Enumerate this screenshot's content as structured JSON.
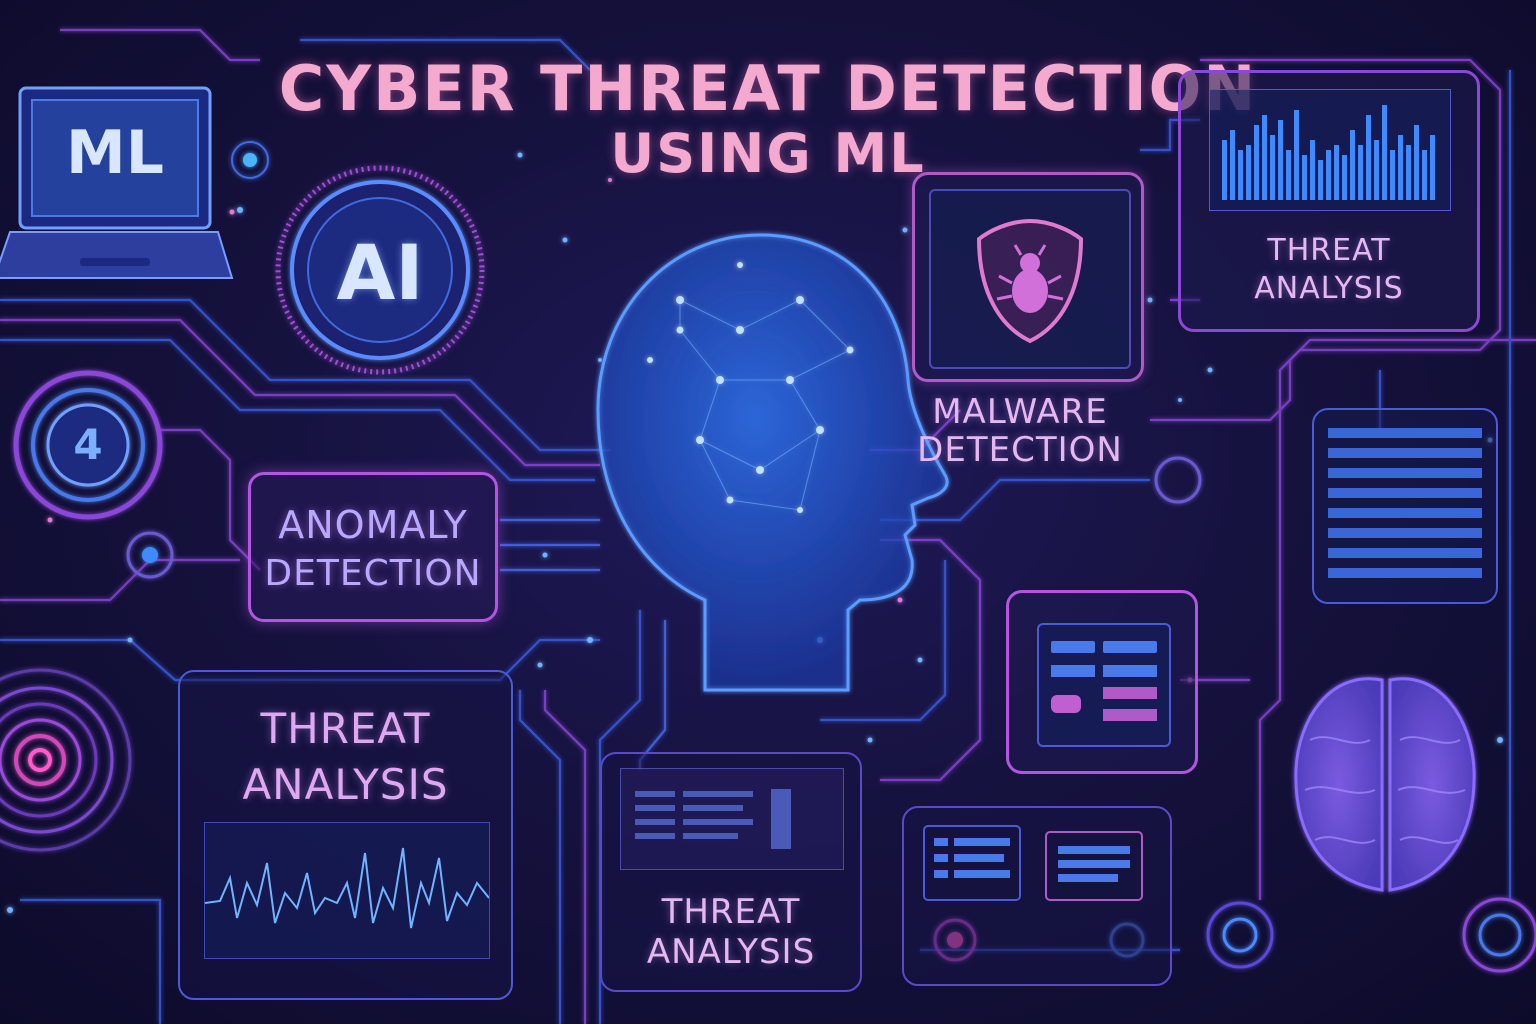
{
  "title": {
    "line1": "CYBER THREAT DETECTION",
    "line2": "USING ML"
  },
  "laptop": {
    "label": "ML"
  },
  "ai_badge": {
    "label": "AI"
  },
  "counter_badge": {
    "value": "4"
  },
  "cards": {
    "anomaly": {
      "line1": "ANOMALY",
      "line2": "DETECTION"
    },
    "threat_left": {
      "line1": "THREAT",
      "line2": "ANALYSIS"
    },
    "threat_bottom": {
      "line1": "THREAT",
      "line2": "ANALYSIS"
    },
    "threat_top_right": {
      "line1": "THREAT",
      "line2": "ANALYSIS"
    },
    "malware": {
      "line1": "MALWARE",
      "line2": "DETECTION"
    }
  },
  "icons": [
    "laptop-icon",
    "shield-bug-icon",
    "head-network-icon",
    "brain-icon",
    "fingerprint-icon"
  ],
  "colors": {
    "title": "#f4a9cf",
    "accent_blue": "#3f7cff",
    "accent_purple": "#b255e0",
    "background": "#14103a"
  }
}
